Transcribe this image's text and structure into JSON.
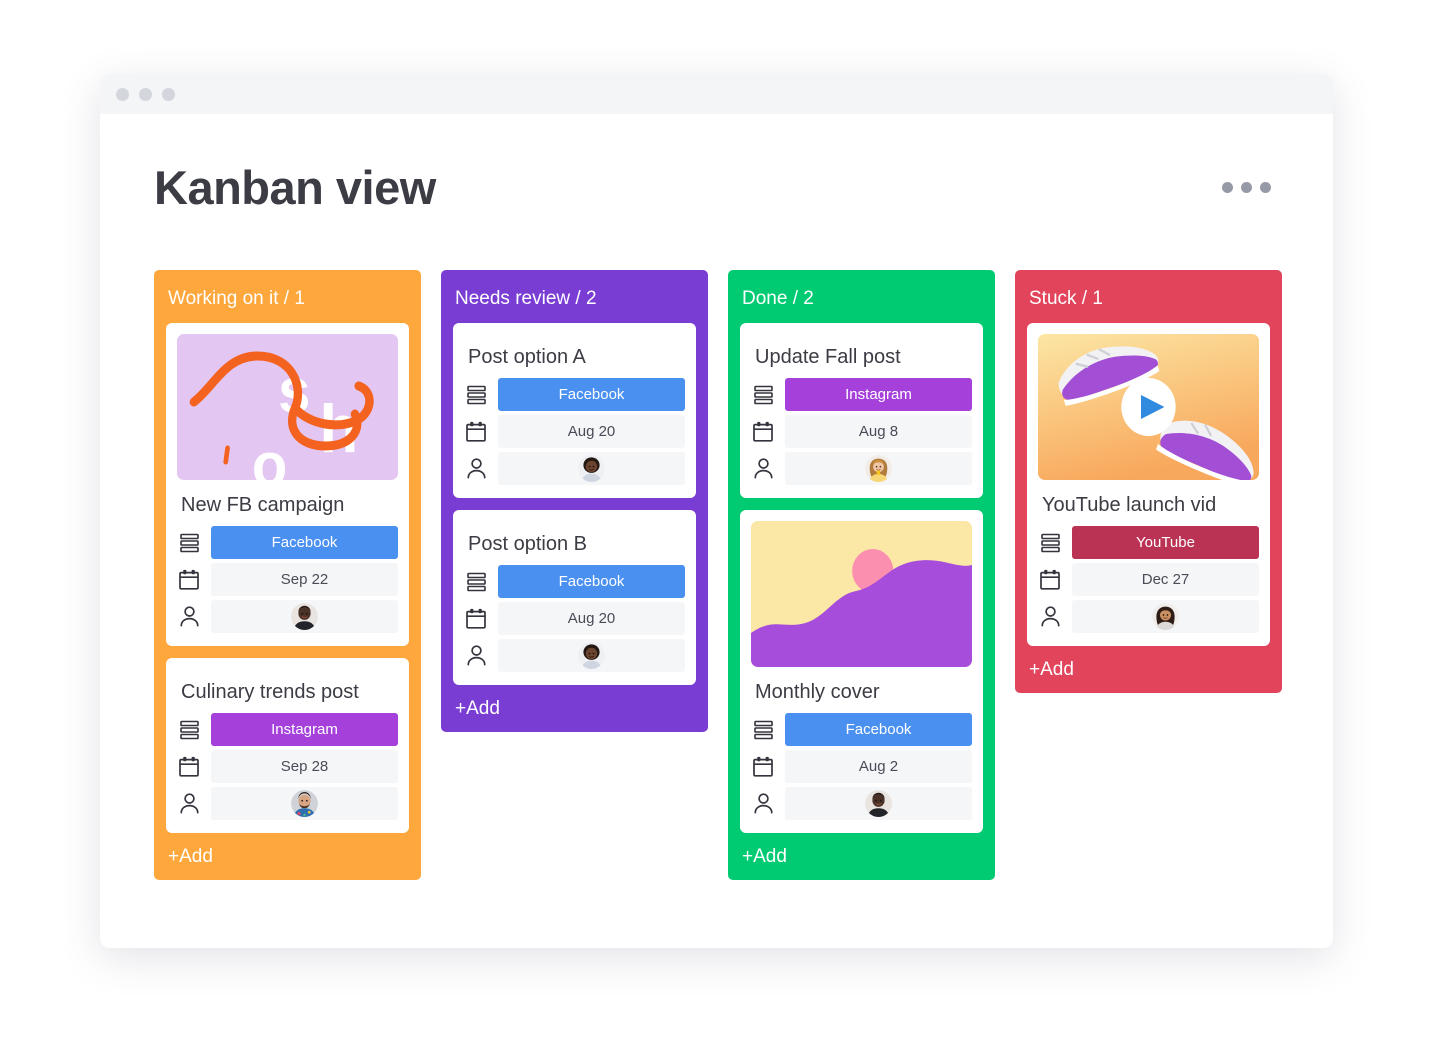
{
  "window": {
    "dots": [
      "close-dot",
      "minimize-dot",
      "maximize-dot"
    ]
  },
  "header": {
    "title": "Kanban view",
    "menu_icon": "more-options-icon"
  },
  "board": {
    "add_label": "+Add",
    "columns": [
      {
        "id": "working-on-it",
        "title": "Working on it / 1",
        "label": "Working on it",
        "count": "1",
        "color": "#FDA73C",
        "cards": [
          {
            "id": "new-fb-campaign",
            "title": "New FB campaign",
            "thumbnail": "shoelace-artwork",
            "status": {
              "label": "Facebook",
              "color": "#4A90F0"
            },
            "date": "Sep 22",
            "person": "avatar-male-dark"
          },
          {
            "id": "culinary-trends-post",
            "title": "Culinary trends post",
            "thumbnail": null,
            "status": {
              "label": "Instagram",
              "color": "#A540DB"
            },
            "date": "Sep 28",
            "person": "avatar-male-beard"
          }
        ]
      },
      {
        "id": "needs-review",
        "title": "Needs review / 2",
        "label": "Needs review",
        "count": "2",
        "color": "#7A3DD4",
        "cards": [
          {
            "id": "post-option-a",
            "title": "Post option A",
            "thumbnail": null,
            "status": {
              "label": "Facebook",
              "color": "#4A90F0"
            },
            "date": "Aug 20",
            "person": "avatar-female-dark"
          },
          {
            "id": "post-option-b",
            "title": "Post option B",
            "thumbnail": null,
            "status": {
              "label": "Facebook",
              "color": "#4A90F0"
            },
            "date": "Aug 20",
            "person": "avatar-female-dark"
          }
        ]
      },
      {
        "id": "done",
        "title": "Done / 2",
        "label": "Done",
        "count": "2",
        "color": "#00CA72",
        "cards": [
          {
            "id": "update-fall-post",
            "title": "Update Fall post",
            "thumbnail": null,
            "status": {
              "label": "Instagram",
              "color": "#A540DB"
            },
            "date": "Aug 8",
            "person": "avatar-female-blonde"
          },
          {
            "id": "monthly-cover",
            "title": "Monthly cover",
            "thumbnail": "landscape-artwork",
            "status": {
              "label": "Facebook",
              "color": "#4A90F0"
            },
            "date": "Aug 2",
            "person": "avatar-male-dark"
          }
        ]
      },
      {
        "id": "stuck",
        "title": "Stuck / 1",
        "label": "Stuck",
        "count": "1",
        "color": "#E2445C",
        "cards": [
          {
            "id": "youtube-launch-vid",
            "title": "YouTube launch vid",
            "thumbnail": "sneaker-video",
            "status": {
              "label": "YouTube",
              "color": "#BB3354"
            },
            "date": "Dec 27",
            "person": "avatar-female-brunette"
          }
        ]
      }
    ],
    "field_icons": {
      "status": "status-list-icon",
      "date": "calendar-icon",
      "person": "person-icon"
    }
  }
}
